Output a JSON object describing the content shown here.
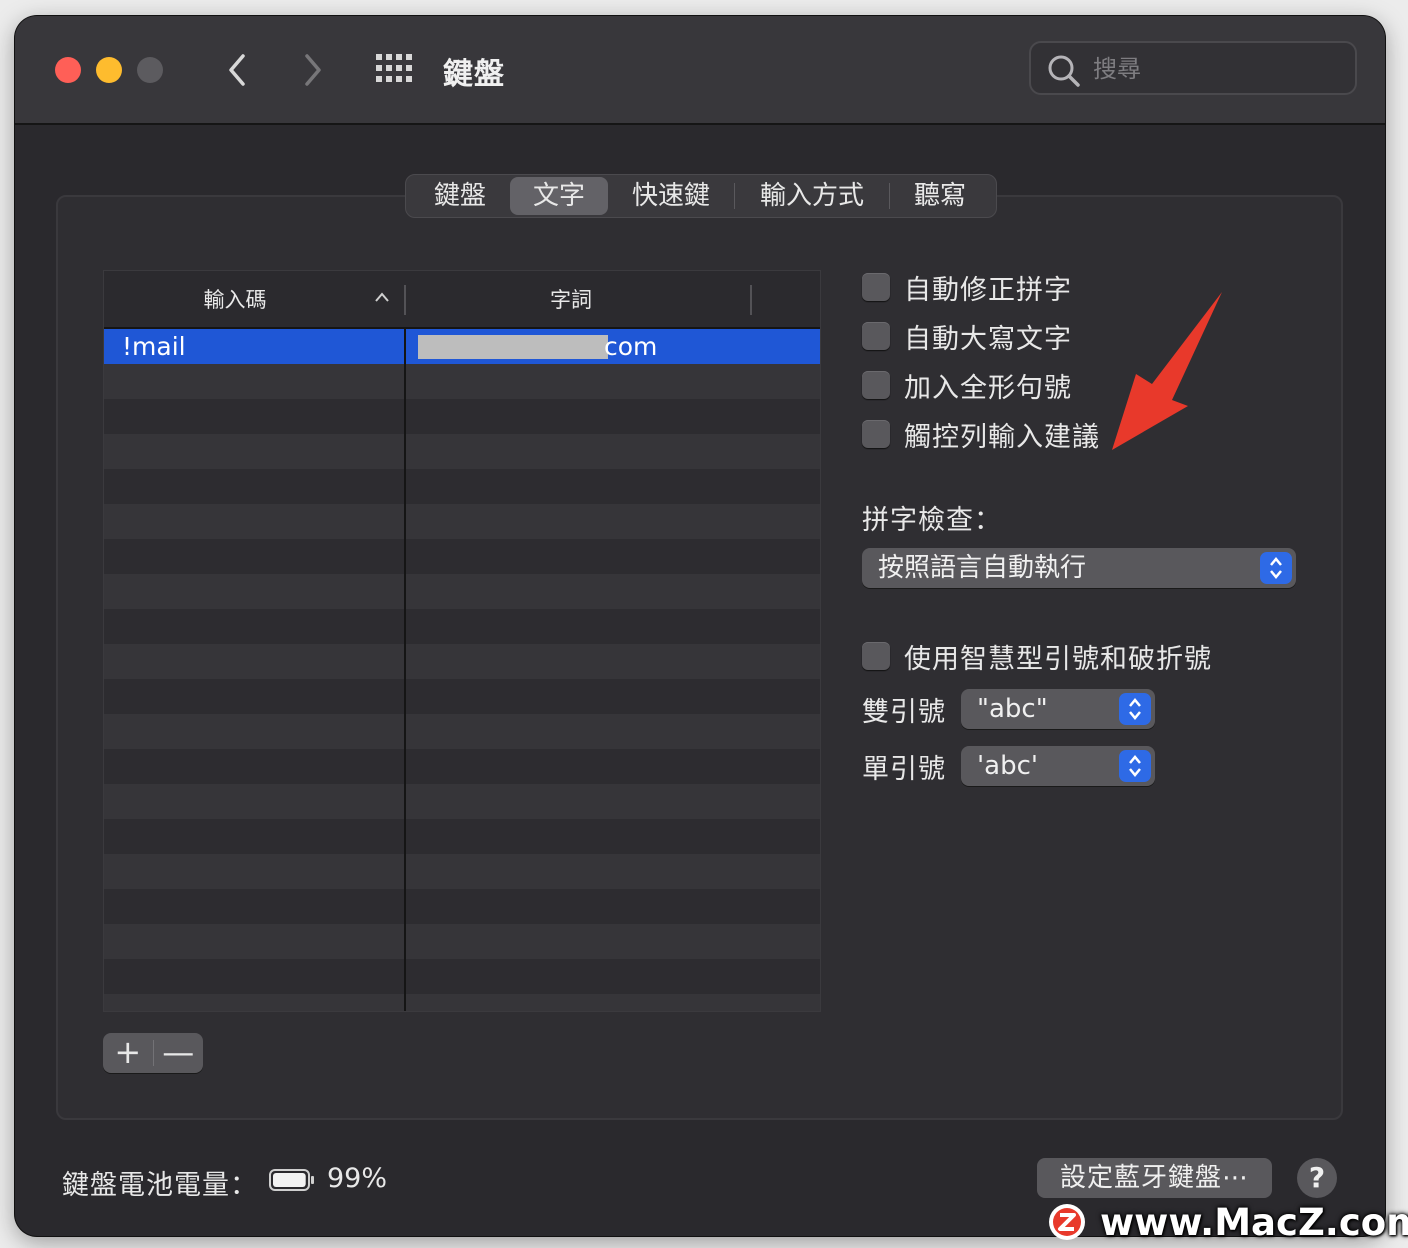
{
  "window": {
    "title": "鍵盤",
    "search_placeholder": "搜尋"
  },
  "tabs": [
    {
      "label": "鍵盤",
      "active": false
    },
    {
      "label": "文字",
      "active": true
    },
    {
      "label": "快速鍵",
      "active": false
    },
    {
      "label": "輸入方式",
      "active": false
    },
    {
      "label": "聽寫",
      "active": false
    }
  ],
  "table": {
    "columns": [
      "輸入碼",
      "字詞"
    ],
    "rows": [
      {
        "replace": "!mail",
        "with": "com",
        "selected": true
      }
    ]
  },
  "buttons": {
    "add": "+",
    "remove": "—",
    "bluetooth": "設定藍牙鍵盤⋯",
    "help": "?"
  },
  "options": {
    "auto_correct": "自動修正拼字",
    "auto_capitalize": "自動大寫文字",
    "fullwidth_period": "加入全形句號",
    "touchbar_suggestions": "觸控列輸入建議"
  },
  "spelling": {
    "label": "拼字檢查：",
    "value": "按照語言自動執行"
  },
  "smart_quotes": {
    "label": "使用智慧型引號和破折號",
    "double_label": "雙引號",
    "double_value": "\"abc\"",
    "single_label": "單引號",
    "single_value": "'abc'"
  },
  "battery": {
    "label": "鍵盤電池電量：",
    "percent": "99%",
    "level": 0.99
  },
  "watermark": "www.MacZ.com",
  "colors": {
    "accent": "#1f57d6",
    "annotation_arrow": "#e8392b",
    "close": "#ff5f57",
    "minimize": "#febc2e"
  }
}
